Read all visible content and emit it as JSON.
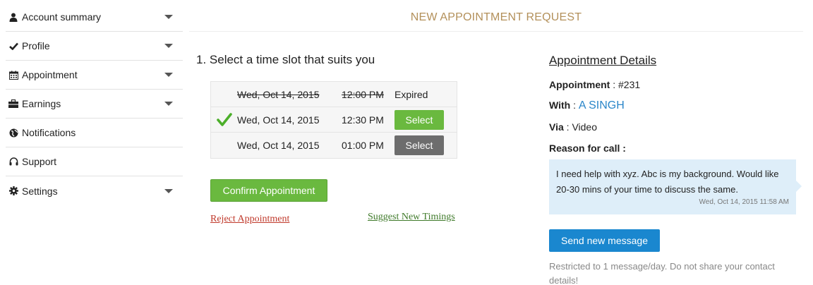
{
  "sidebar": {
    "items": [
      {
        "label": "Account summary",
        "icon": "user-icon",
        "expandable": true
      },
      {
        "label": "Profile",
        "icon": "check-icon",
        "expandable": true
      },
      {
        "label": "Appointment",
        "icon": "calendar-icon",
        "expandable": true
      },
      {
        "label": "Earnings",
        "icon": "briefcase-icon",
        "expandable": true
      },
      {
        "label": "Notifications",
        "icon": "globe-icon",
        "expandable": false
      },
      {
        "label": "Support",
        "icon": "headphones-icon",
        "expandable": false
      },
      {
        "label": "Settings",
        "icon": "gear-icon",
        "expandable": true
      }
    ]
  },
  "header": {
    "title": "NEW APPOINTMENT REQUEST"
  },
  "slots_section": {
    "heading": "1. Select a time slot that suits you",
    "slots": [
      {
        "date": "Wed, Oct 14, 2015",
        "time": "12:00 PM",
        "status": "Expired"
      },
      {
        "date": "Wed, Oct 14, 2015",
        "time": "12:30 PM",
        "action": "Select",
        "selected": true
      },
      {
        "date": "Wed, Oct 14, 2015",
        "time": "01:00 PM",
        "action": "Select",
        "selected": false
      }
    ],
    "confirm_label": "Confirm Appointment",
    "reject_label": "Reject Appointment",
    "suggest_label": "Suggest New Timings"
  },
  "details": {
    "title": "Appointment Details",
    "appointment_label": "Appointment",
    "appointment_value": "#231",
    "with_label": "With",
    "with_value": "A SINGH",
    "via_label": "Via",
    "via_value": "Video",
    "reason_label": "Reason for call :",
    "message": "I need help with xyz. Abc is my background. Would like 20-30 mins of your time to discuss the same.",
    "message_time": "Wed, Oct 14, 2015 11:58 AM",
    "send_label": "Send new message",
    "restriction": "Restricted to 1 message/day. Do not share your contact details!"
  },
  "colors": {
    "title": "#b3905a",
    "green": "#6ab93f",
    "gray": "#6d6d6d",
    "blue": "#1a87cf",
    "message_bg": "#deeef9"
  }
}
